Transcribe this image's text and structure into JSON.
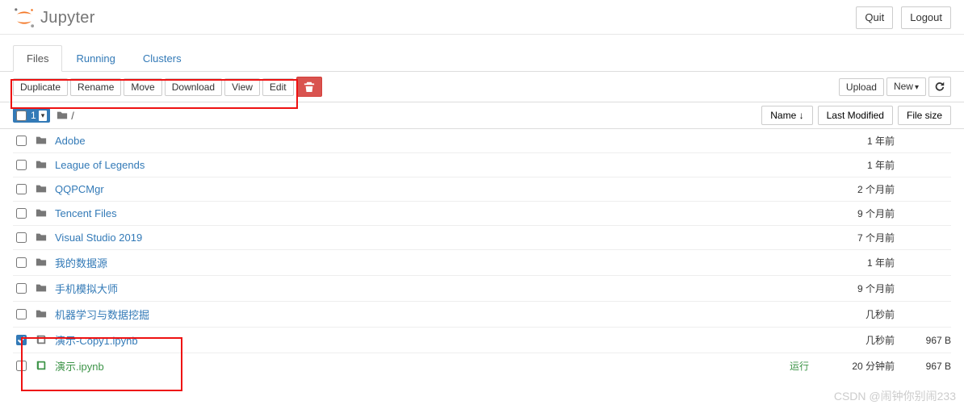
{
  "header": {
    "logo_text": "Jupyter",
    "quit_label": "Quit",
    "logout_label": "Logout"
  },
  "tabs": {
    "files": "Files",
    "running": "Running",
    "clusters": "Clusters"
  },
  "toolbar": {
    "duplicate": "Duplicate",
    "rename": "Rename",
    "move": "Move",
    "download": "Download",
    "view": "View",
    "edit": "Edit",
    "upload": "Upload",
    "new": "New"
  },
  "selector": {
    "count": "1"
  },
  "breadcrumb": {
    "root": "/"
  },
  "columns": {
    "name": "Name",
    "modified": "Last Modified",
    "size": "File size"
  },
  "files": [
    {
      "type": "dir",
      "name": "Adobe",
      "modified": "1 年前",
      "size": "",
      "checked": false
    },
    {
      "type": "dir",
      "name": "League of Legends",
      "modified": "1 年前",
      "size": "",
      "checked": false
    },
    {
      "type": "dir",
      "name": "QQPCMgr",
      "modified": "2 个月前",
      "size": "",
      "checked": false
    },
    {
      "type": "dir",
      "name": "Tencent Files",
      "modified": "9 个月前",
      "size": "",
      "checked": false
    },
    {
      "type": "dir",
      "name": "Visual Studio 2019",
      "modified": "7 个月前",
      "size": "",
      "checked": false
    },
    {
      "type": "dir",
      "name": "我的数据源",
      "modified": "1 年前",
      "size": "",
      "checked": false
    },
    {
      "type": "dir",
      "name": "手机模拟大师",
      "modified": "9 个月前",
      "size": "",
      "checked": false
    },
    {
      "type": "dir",
      "name": "机器学习与数据挖掘",
      "modified": "几秒前",
      "size": "",
      "checked": false
    },
    {
      "type": "nb",
      "name": "演示-Copy1.ipynb",
      "modified": "几秒前",
      "size": "967 B",
      "checked": true,
      "running": false
    },
    {
      "type": "nb",
      "name": "演示.ipynb",
      "modified": "20 分钟前",
      "size": "967 B",
      "checked": false,
      "running": true,
      "status": "运行"
    }
  ],
  "watermark": "CSDN @闹钟你别闹233"
}
